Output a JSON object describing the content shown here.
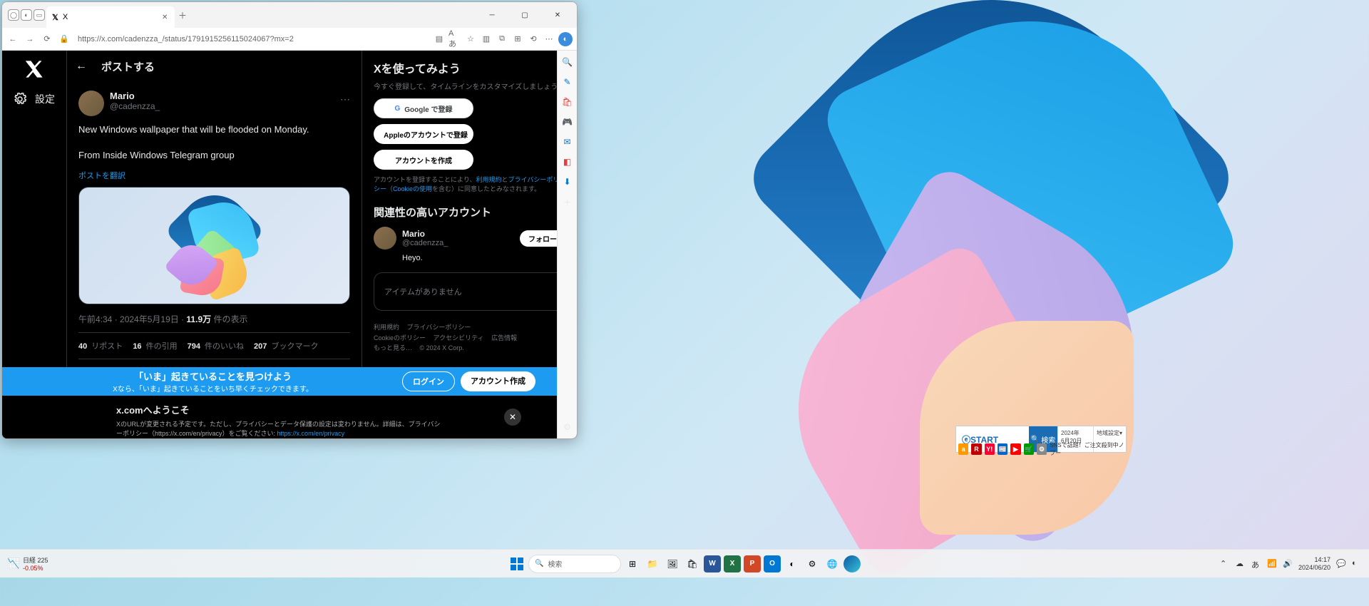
{
  "browser": {
    "tab_title": "X",
    "url": "https://x.com/cadenzza_/status/1791915256115024067?mx=2"
  },
  "nav": {
    "settings": "設定"
  },
  "column_header": "ポストする",
  "post": {
    "author_name": "Mario",
    "author_handle": "@cadenzza_",
    "line1": "New Windows wallpaper that will be flooded on Monday.",
    "line2": "From Inside Windows Telegram group",
    "translate": "ポストを翻訳",
    "time": "午前4:34 · 2024年5月19日",
    "views_num": "11.9万",
    "views_label": " 件の表示",
    "reposts_n": "40",
    "reposts_l": " リポスト",
    "quotes_n": "16",
    "quotes_l": " 件の引用",
    "likes_n": "794",
    "likes_l": " 件のいいね",
    "bookmarks_n": "207",
    "bookmarks_l": " ブックマーク",
    "bookmark_count": "207"
  },
  "signup": {
    "title": "Xを使ってみよう",
    "subtitle": "今すぐ登録して、タイムラインをカスタマイズしましょう。",
    "google": "Google で登録",
    "apple": "Appleのアカウントで登録",
    "create": "アカウントを作成",
    "terms_pre": "アカウントを登録することにより、",
    "terms_link1": "利用規約",
    "terms_and": "と",
    "terms_link2": "プライバシーポリシー",
    "terms_mid": "（",
    "terms_link3": "Cookieの使用",
    "terms_post": "を含む）に同意したとみなされます。"
  },
  "related": {
    "title": "関連性の高いアカウント",
    "name": "Mario",
    "handle": "@cadenzza_",
    "bio": "Heyo.",
    "follow": "フォロー",
    "empty": "アイテムがありません"
  },
  "footer": {
    "l1": "利用規約",
    "l2": "プライバシーポリシー",
    "l3": "Cookieのポリシー",
    "l4": "アクセシビリティ",
    "l5": "広告情報",
    "l6": "もっと見る…",
    "copy": "© 2024 X Corp."
  },
  "banner": {
    "title": "「いま」起きていることを見つけよう",
    "sub": "Xなら、「いま」起きていることをいち早くチェックできます。",
    "login": "ログイン",
    "signup": "アカウント作成"
  },
  "cookie": {
    "title": "x.comへようこそ",
    "text_pre": "XのURLが変更される予定です。ただし、プライバシーとデータ保護の設定は変わりません。詳細は、プライバシーポリシー（https://x.com/en/privacy）をご覧ください: ",
    "link": "https://x.com/en/privacy"
  },
  "start_widget": {
    "logo": "ⓔSTART",
    "search": "検索",
    "date1": "2024年",
    "date2": "6月20日",
    "region": "地域設定▾",
    "promo": "SNSで話題！ご注文殺到中ノブー"
  },
  "taskbar": {
    "stock_label": "日経 225",
    "stock_change": "-0.05%",
    "search_placeholder": "検索",
    "ime": "あ",
    "time": "14:17",
    "date": "2024/06/20"
  }
}
